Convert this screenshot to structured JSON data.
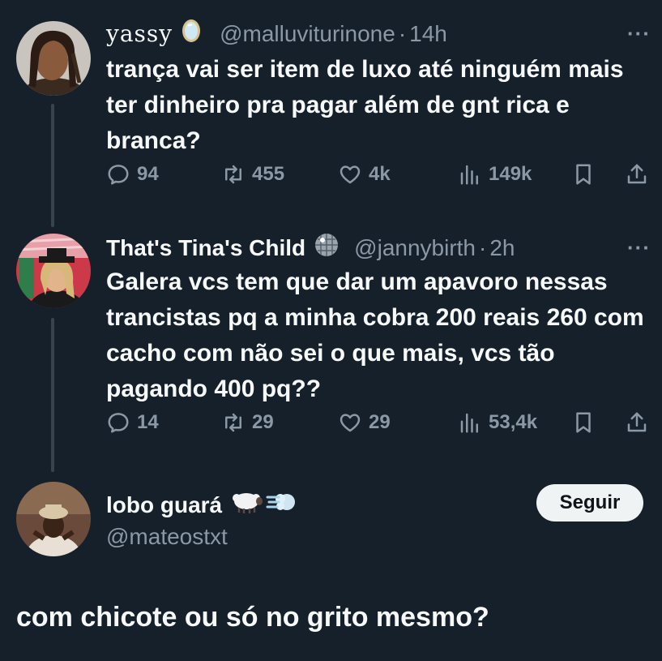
{
  "tweets": [
    {
      "name": "yassy",
      "handle": "@malluviturinone",
      "time": "14h",
      "text": "trança vai ser item de luxo até ninguém mais ter dinheiro pra pagar além de gnt rica e branca?",
      "replies": "94",
      "retweets": "455",
      "likes": "4k",
      "views": "149k",
      "badge_icon": "mirror-icon"
    },
    {
      "name": "That's Tina's Child",
      "handle": "@jannybirth",
      "time": "2h",
      "text": "Galera vcs tem que dar um apavoro nessas trancistas pq a minha cobra 200 reais 260 com cacho com não sei o que mais, vcs tão pagando 400 pq??",
      "replies": "14",
      "retweets": "29",
      "likes": "29",
      "views": "53,4k",
      "badge_icon": "disco-ball-icon"
    }
  ],
  "quote": {
    "name": "lobo guará",
    "handle": "@mateostxt",
    "follow_label": "Seguir",
    "text": "com chicote ou só no grito mesmo?",
    "badge_icons": [
      "sheep-icon",
      "dash-icon"
    ]
  },
  "sep": "·",
  "more": "···",
  "colors": {
    "background": "#15202b",
    "text": "#f7f9f9",
    "muted": "#8b98a5",
    "button_bg": "#eff3f4"
  }
}
